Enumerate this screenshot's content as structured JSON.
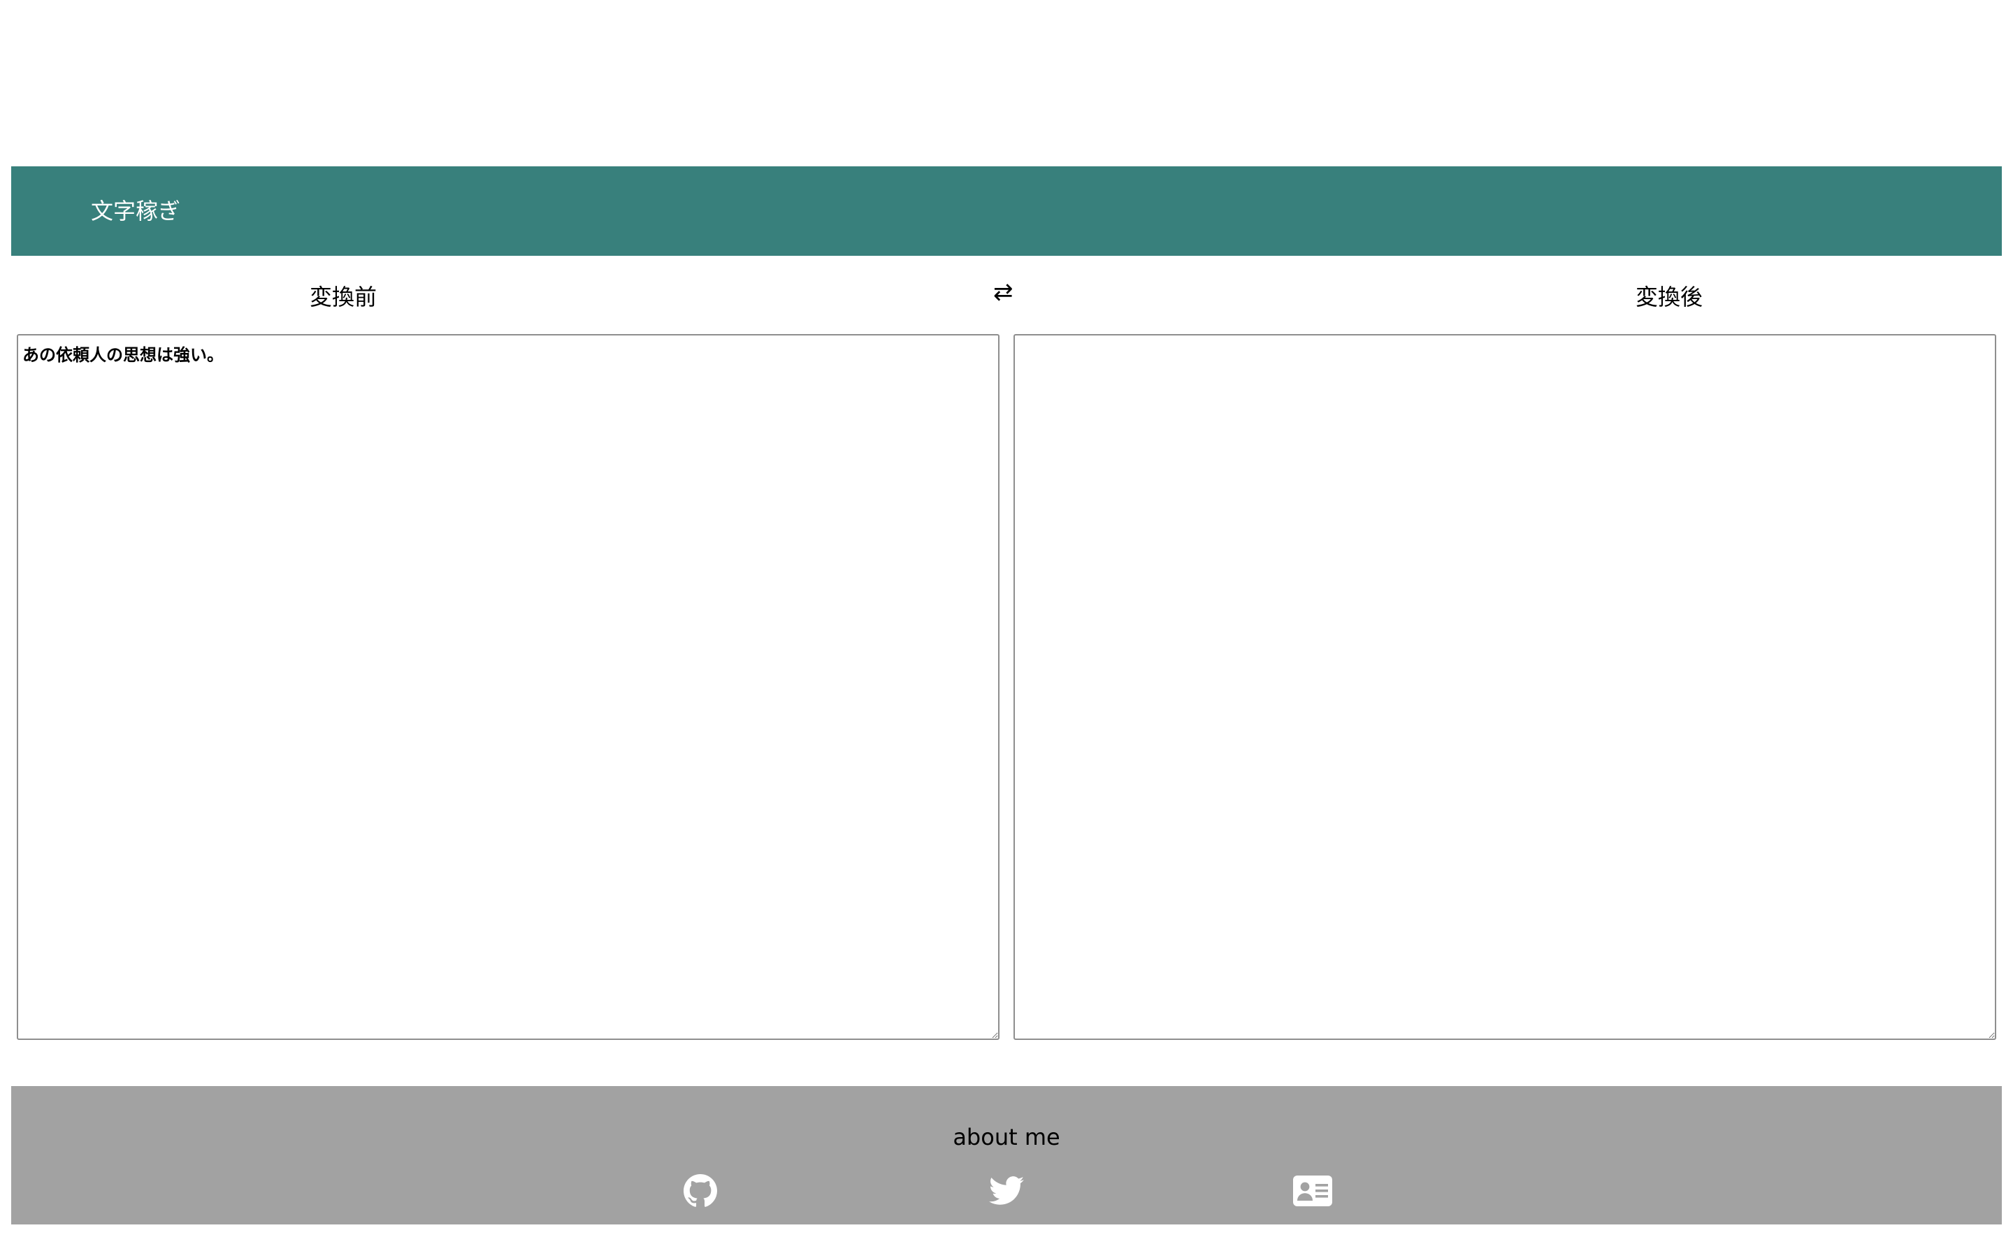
{
  "header": {
    "title": "文字稼ぎ"
  },
  "labels": {
    "before": "変換前",
    "swap": "⇄",
    "after": "変換後"
  },
  "editor": {
    "before_value": "あの依頼人の思想は強い。",
    "after_value": ""
  },
  "footer": {
    "title": "about me",
    "links": [
      {
        "icon": "github-icon"
      },
      {
        "icon": "twitter-icon"
      },
      {
        "icon": "profile-card-icon"
      }
    ]
  },
  "colors": {
    "header_bg": "#38807c",
    "footer_bg": "#a2a2a2",
    "header_text": "#ffffff"
  }
}
